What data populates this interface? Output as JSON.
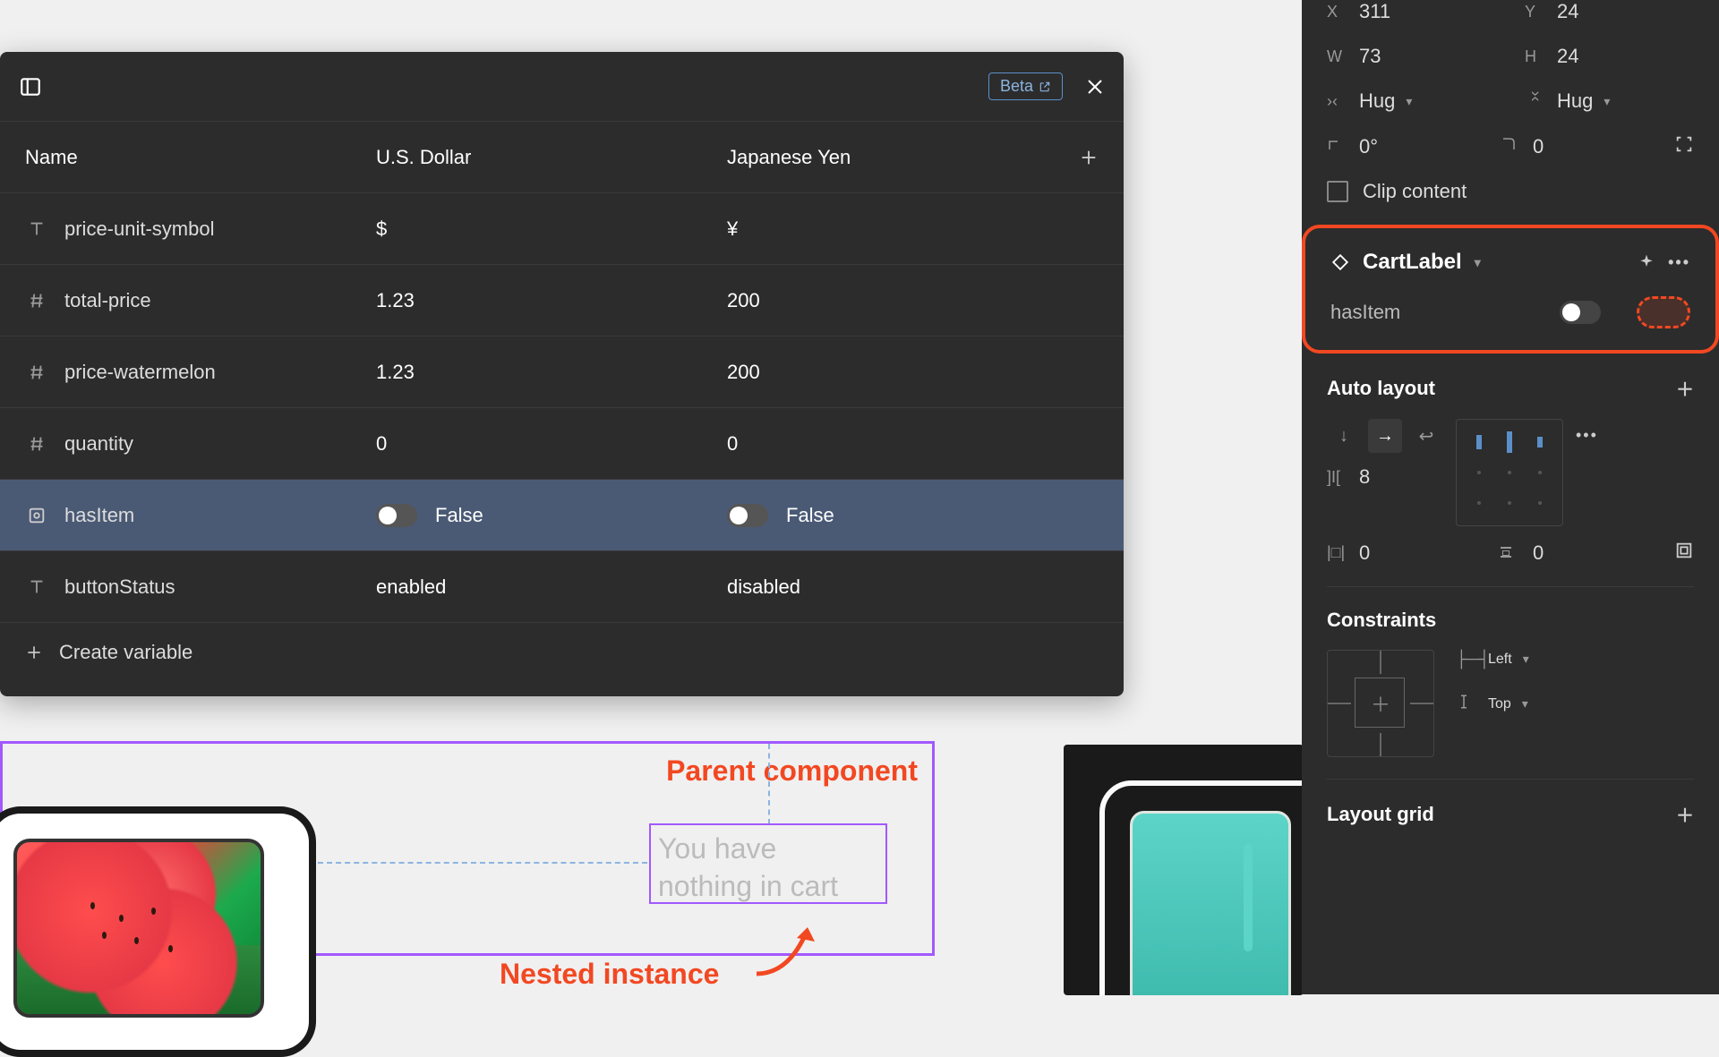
{
  "variablesPanel": {
    "betaLabel": "Beta",
    "columns": {
      "name": "Name",
      "us": "U.S. Dollar",
      "jp": "Japanese Yen"
    },
    "rows": [
      {
        "type": "text",
        "name": "price-unit-symbol",
        "us": "$",
        "jp": "¥"
      },
      {
        "type": "number",
        "name": "total-price",
        "us": "1.23",
        "jp": "200"
      },
      {
        "type": "number",
        "name": "price-watermelon",
        "us": "1.23",
        "jp": "200"
      },
      {
        "type": "number",
        "name": "quantity",
        "us": "0",
        "jp": "0"
      },
      {
        "type": "boolean",
        "name": "hasItem",
        "us": "False",
        "jp": "False",
        "selected": true
      },
      {
        "type": "text",
        "name": "buttonStatus",
        "us": "enabled",
        "jp": "disabled"
      }
    ],
    "createVariable": "Create variable"
  },
  "canvas": {
    "parentLabel": "Parent component",
    "nestedLabel": "Nested instance",
    "cartTextLine1": "You have",
    "cartTextLine2": "nothing in cart"
  },
  "inspector": {
    "position": {
      "xLabel": "X",
      "x": "311",
      "yLabel": "Y",
      "y": "24"
    },
    "size": {
      "wLabel": "W",
      "w": "73",
      "hLabel": "H",
      "h": "24"
    },
    "resize": {
      "horiz": "Hug",
      "vert": "Hug"
    },
    "rotation": "0°",
    "cornerRadius": "0",
    "clipContent": "Clip content",
    "cartLabel": {
      "title": "CartLabel",
      "propName": "hasItem"
    },
    "autoLayout": {
      "title": "Auto layout",
      "gap": "8",
      "padH": "0",
      "padV": "0"
    },
    "constraints": {
      "title": "Constraints",
      "h": "Left",
      "v": "Top"
    },
    "layoutGrid": {
      "title": "Layout grid"
    }
  }
}
